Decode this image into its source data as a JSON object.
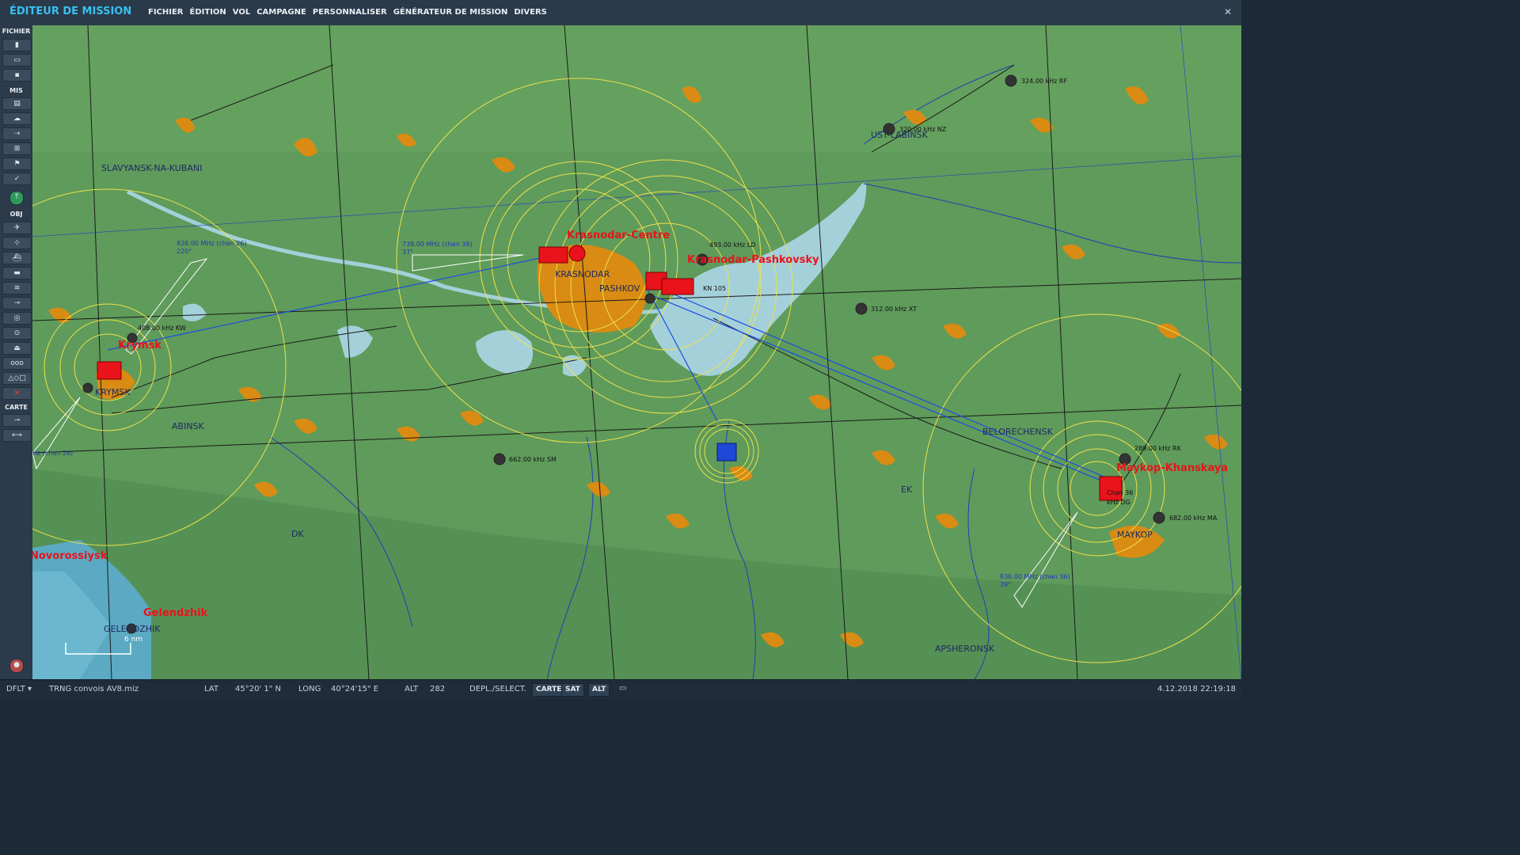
{
  "window": {
    "title": "ÉDITEUR DE MISSION",
    "close": "✕"
  },
  "menu": [
    "FICHIER",
    "ÉDITION",
    "VOL",
    "CAMPAGNE",
    "PERSONNALISER",
    "GÉNÉRATEUR DE MISSION",
    "DIVERS"
  ],
  "toolbar": {
    "fichier": "FICHIER",
    "mis": "MIS",
    "obj": "OBJ",
    "carte": "CARTE"
  },
  "map": {
    "cities": [
      "SLAVYANSK-NA-KUBANI",
      "KRASNODAR",
      "PASHKOV",
      "UST-LABINSK",
      "KRYMSK",
      "ABINSK",
      "DK",
      "BELORECHENSK",
      "EK",
      "MAYKOP",
      "APSHERONSK",
      "GELENDZHIK"
    ],
    "airbases": [
      "Krasnodar-Centre",
      "Krasnodar-Pashkovsky",
      "Krymsk",
      "Novorossiysk",
      "Gelendzhik",
      "Maykop-Khanskaya"
    ],
    "navaids": [
      "324.00 kHz RF",
      "320.00 kHz NZ",
      "493.00 kHz LD",
      "312.00 kHz XT",
      "408.00 kHz KW",
      "662.00 kHz SM",
      "289.00 kHz RK",
      "682.00 kHz MA",
      "KN 105",
      "kHz DG",
      "Chan 36"
    ],
    "frequencies": [
      "826.00 MHz (chan 26)",
      "220°",
      "738.00 MHz (chan 38)",
      "37°",
      "836.00 MHz (chan 36)",
      "39°",
      "Hz (chan 26)"
    ],
    "scale_label": "6 nm"
  },
  "status": {
    "profile": "DFLT",
    "file": "TRNG convois AV8.miz",
    "lat_label": "LAT",
    "lat": "45°20' 1\" N",
    "long_label": "LONG",
    "long": "40°24'15\" E",
    "alt_label": "ALT",
    "alt": "282",
    "depl_label": "DEPL./SELECT.",
    "btn_carte": "CARTE",
    "btn_sat": "SAT",
    "btn_alt": "ALT",
    "datetime": "4.12.2018 22:19:18"
  }
}
